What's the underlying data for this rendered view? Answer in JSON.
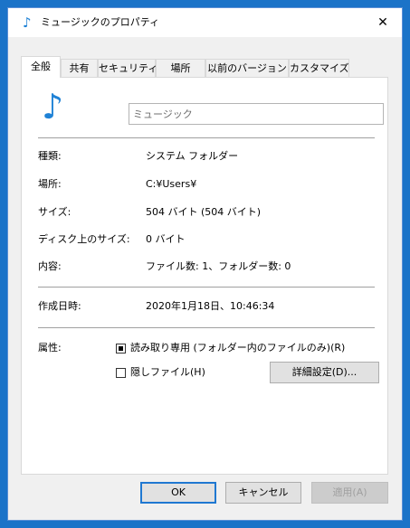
{
  "window": {
    "title": "ミュージックのプロパティ",
    "title_icon": "music-note-icon",
    "close_glyph": "✕"
  },
  "tabs": [
    {
      "label": "全般",
      "active": true
    },
    {
      "label": "共有"
    },
    {
      "label": "セキュリティ"
    },
    {
      "label": "場所"
    },
    {
      "label": "以前のバージョン"
    },
    {
      "label": "カスタマイズ"
    }
  ],
  "general": {
    "big_icon": "music-note-icon",
    "name_value": "ミュージック",
    "rows": [
      {
        "label": "種類:",
        "value": "システム フォルダー"
      },
      {
        "label": "場所:",
        "value": "C:¥Users¥"
      },
      {
        "label": "サイズ:",
        "value": "504 バイト (504 バイト)"
      },
      {
        "label": "ディスク上のサイズ:",
        "value": "0 バイト"
      },
      {
        "label": "内容:",
        "value": "ファイル数: 1、フォルダー数: 0"
      }
    ],
    "created_label": "作成日時:",
    "created_value": "2020年1月18日、10:46:34",
    "attributes_label": "属性:",
    "readonly_label": "読み取り専用 (フォルダー内のファイルのみ)(R)",
    "readonly_state": "indeterminate",
    "hidden_label": "隠しファイル(H)",
    "hidden_state": "unchecked",
    "advanced_label": "詳細設定(D)..."
  },
  "buttons": {
    "ok": "OK",
    "cancel": "キャンセル",
    "apply": "適用(A)"
  },
  "colors": {
    "desktop": "#1b73c8",
    "accent": "#1f78d1",
    "icon": "#1f82d6"
  }
}
